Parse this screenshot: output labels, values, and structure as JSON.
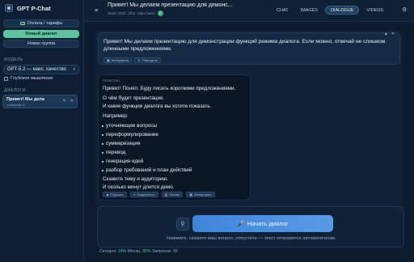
{
  "sidebar": {
    "app_title": "GPT P-Chat",
    "pay_button": "Оплата / тарифы",
    "pay_icon": "card-icon",
    "new_dialog": "Новый диалог",
    "new_group": "Новая группа",
    "model_section": "МОДЕЛЬ",
    "model_value": "GPT-5.2 — макс. качество",
    "deep_thinking": "Глубокое мышление",
    "dialogs_section": "ДИАЛОГИ",
    "chats": [
      {
        "title": "Привет! Мы дела",
        "subtitle": "сообщений: 4"
      }
    ]
  },
  "header": {
    "title": "Привет! Мы делаем презентацию для демонс...",
    "client_id": "client: d22f...3f18",
    "plan": "plan: basic",
    "tabs": [
      {
        "label": "CHAT",
        "active": false
      },
      {
        "label": "IMAGES",
        "active": false
      },
      {
        "label": "DIALOGUE",
        "active": true
      },
      {
        "label": "VIDEOS",
        "active": false
      }
    ]
  },
  "messages": {
    "user": {
      "text": "Привет! Мы делаем презентацию для демонстрации функций режима диалога. Если можно, отвечай не слишком длинными предложениями.",
      "copy": "Копировать",
      "repeat": "Повторить"
    },
    "assistant": {
      "label": "Ассистент",
      "lines": [
        "Привет! Понял. Буду писать короткими предложениями.",
        "О чём будет презентация.",
        "И какие функции диалога вы хотите показать.",
        "Например:"
      ],
      "bullets": [
        "уточняющие вопросы",
        "переформулирование",
        "суммаризация",
        "перевод",
        "генерация идей",
        "разбор требований и план действий"
      ],
      "closing": [
        "Скажите тему и аудиторию.",
        "И сколько минут длится демо."
      ],
      "actions": {
        "listen": "Слушать",
        "share": "Поделиться",
        "print": "Печать",
        "copy": "Копировать"
      }
    }
  },
  "composer": {
    "start_button": "Начать диалог",
    "hint": "Нажмите, скажите ваш вопрос, отпустите — текст отправится автоматически."
  },
  "stats": {
    "today_label": "Сегодня:",
    "today_value": "14%",
    "month_label": "Месяц:",
    "month_value": "35%",
    "requests_label": "Запросов:",
    "requests_value": "30"
  },
  "colors": {
    "accent_green": "#5fc49d",
    "accent_blue": "#3d85dc",
    "background": "#0b1a2c"
  }
}
